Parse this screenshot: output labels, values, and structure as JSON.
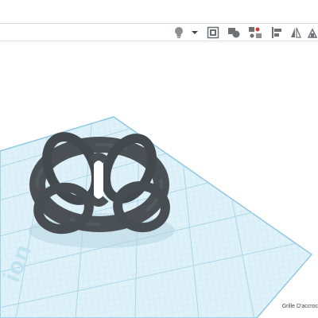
{
  "toolbar": {
    "icons": [
      "lightbulb-icon",
      "dropdown-arrow-icon",
      "workplane-icon",
      "group-shapes-icon",
      "ungroup-icon",
      "align-icon",
      "mirror-icon",
      "cruise-icon"
    ]
  },
  "viewport": {
    "watermark": "ion",
    "snap_grid_label": "Grille D'accroc"
  },
  "colors": {
    "grid_fill": "#dff1f9",
    "grid_line": "#b9dfee",
    "grid_edge": "#8cc8e2",
    "model": "#4a5054"
  }
}
